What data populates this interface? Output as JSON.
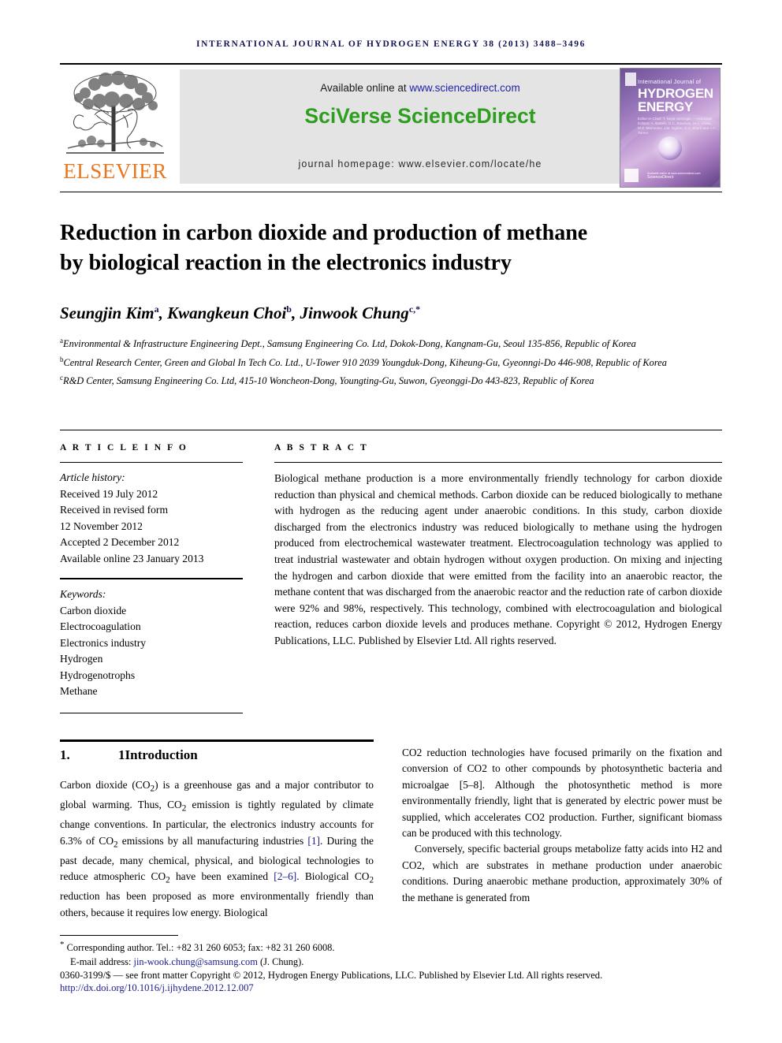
{
  "running_head": "International Journal of Hydrogen Energy 38 (2013) 3488–3496",
  "masthead": {
    "publisher_name": "ELSEVIER",
    "available_prefix": "Available online at ",
    "available_url": "www.sciencedirect.com",
    "platform": "SciVerse ScienceDirect",
    "homepage": "journal homepage: www.elsevier.com/locate/he",
    "cover": {
      "line_small": "International Journal of",
      "line_big_1": "HYDROGEN",
      "line_big_2": "ENERGY",
      "editors": "Editor-in-Chief: T. Nejat Veziroglu — Associate Editors: A. Bartels, D.C. Bowman, M.A. Lewis, M.Z. Mamedov, J.M. Ogden, S.A. Sherif and J.A. Turner",
      "sciencedirect_mark": "ScienceDirect",
      "sciencedirect_mark_small": "Available online at www.sciencedirect.com"
    },
    "colors": {
      "band_bg": "#e4e4e4",
      "sciverse_green": "#2e9e1f",
      "link_blue": "#2222aa",
      "elsevier_orange": "#E87722"
    }
  },
  "article": {
    "title": "Reduction in carbon dioxide and production of methane by biological reaction in the electronics industry",
    "authors": [
      {
        "name": "Seungjin Kim",
        "sup": "a"
      },
      {
        "name": "Kwangkeun Choi",
        "sup": "b"
      },
      {
        "name": "Jinwook Chung",
        "sup": "c,*"
      }
    ],
    "affiliations": [
      {
        "marker": "a",
        "text": "Environmental & Infrastructure Engineering Dept., Samsung Engineering Co. Ltd, Dokok-Dong, Kangnam-Gu, Seoul 135-856, Republic of Korea"
      },
      {
        "marker": "b",
        "text": "Central Research Center, Green and Global In Tech Co. Ltd., U-Tower 910 2039 Youngduk-Dong, Kiheung-Gu, Gyeonngi-Do 446-908, Republic of Korea"
      },
      {
        "marker": "c",
        "text": "R&D Center, Samsung Engineering Co. Ltd, 415-10 Woncheon-Dong, Youngting-Gu, Suwon, Gyeonggi-Do 443-823, Republic of Korea"
      }
    ]
  },
  "article_info": {
    "heading": "A R T I C L E   I N F O",
    "history_label": "Article history:",
    "history": [
      "Received 19 July 2012",
      "Received in revised form",
      "12 November 2012",
      "Accepted 2 December 2012",
      "Available online 23 January 2013"
    ],
    "keywords_label": "Keywords:",
    "keywords": [
      "Carbon dioxide",
      "Electrocoagulation",
      "Electronics industry",
      "Hydrogen",
      "Hydrogenotrophs",
      "Methane"
    ]
  },
  "abstract": {
    "heading": "A B S T R A C T",
    "body": "Biological methane production is a more environmentally friendly technology for carbon dioxide reduction than physical and chemical methods. Carbon dioxide can be reduced biologically to methane with hydrogen as the reducing agent under anaerobic conditions. In this study, carbon dioxide discharged from the electronics industry was reduced biologically to methane using the hydrogen produced from electrochemical wastewater treatment. Electrocoagulation technology was applied to treat industrial wastewater and obtain hydrogen without oxygen production. On mixing and injecting the hydrogen and carbon dioxide that were emitted from the facility into an anaerobic reactor, the methane content that was discharged from the anaerobic reactor and the reduction rate of carbon dioxide were 92% and 98%, respectively. This technology, combined with electrocoagulation and biological reaction, reduces carbon dioxide levels and produces methane.",
    "copyright": "Copyright © 2012, Hydrogen Energy Publications, LLC. Published by Elsevier Ltd. All rights reserved."
  },
  "section": {
    "number": "1.",
    "title": "1Introduction"
  },
  "body": {
    "left_paragraph_parts": [
      "Carbon dioxide (CO",
      "2",
      ") is a greenhouse gas and a major contributor to global warming. Thus, CO",
      "2",
      " emission is tightly regulated by climate change conventions. In particular, the electronics industry accounts for 6.3% of CO",
      "2",
      " emissions by all manufacturing industries ",
      "[1]",
      ". During the past decade, many chemical, physical, and biological technologies to reduce atmospheric CO",
      "2",
      " have been examined ",
      "[2–6]",
      ". Biological CO",
      "2",
      " reduction has been proposed as more environmentally friendly than others, because it requires low energy. Biological"
    ],
    "right_paragraph_1": "CO2 reduction technologies have focused primarily on the fixation and conversion of CO2 to other compounds by photosynthetic bacteria and microalgae [5–8]. Although the photosynthetic method is more environmentally friendly, light that is generated by electric power must be supplied, which accelerates CO2 production. Further, significant biomass can be produced with this technology.",
    "right_paragraph_2": "Conversely, specific bacterial groups metabolize fatty acids into H2 and CO2, which are substrates in methane production under anaerobic conditions. During anaerobic methane production, approximately 30% of the methane is generated from"
  },
  "footer": {
    "corresponding": "Corresponding author. Tel.: +82 31 260 6053; fax: +82 31 260 6008.",
    "email_label": "E-mail address: ",
    "email": "jin-wook.chung@samsung.com",
    "email_suffix": " (J. Chung).",
    "copyright_line": "0360-3199/$ — see front matter Copyright © 2012, Hydrogen Energy Publications, LLC. Published by Elsevier Ltd. All rights reserved.",
    "doi": "http://dx.doi.org/10.1016/j.ijhydene.2012.12.007"
  }
}
